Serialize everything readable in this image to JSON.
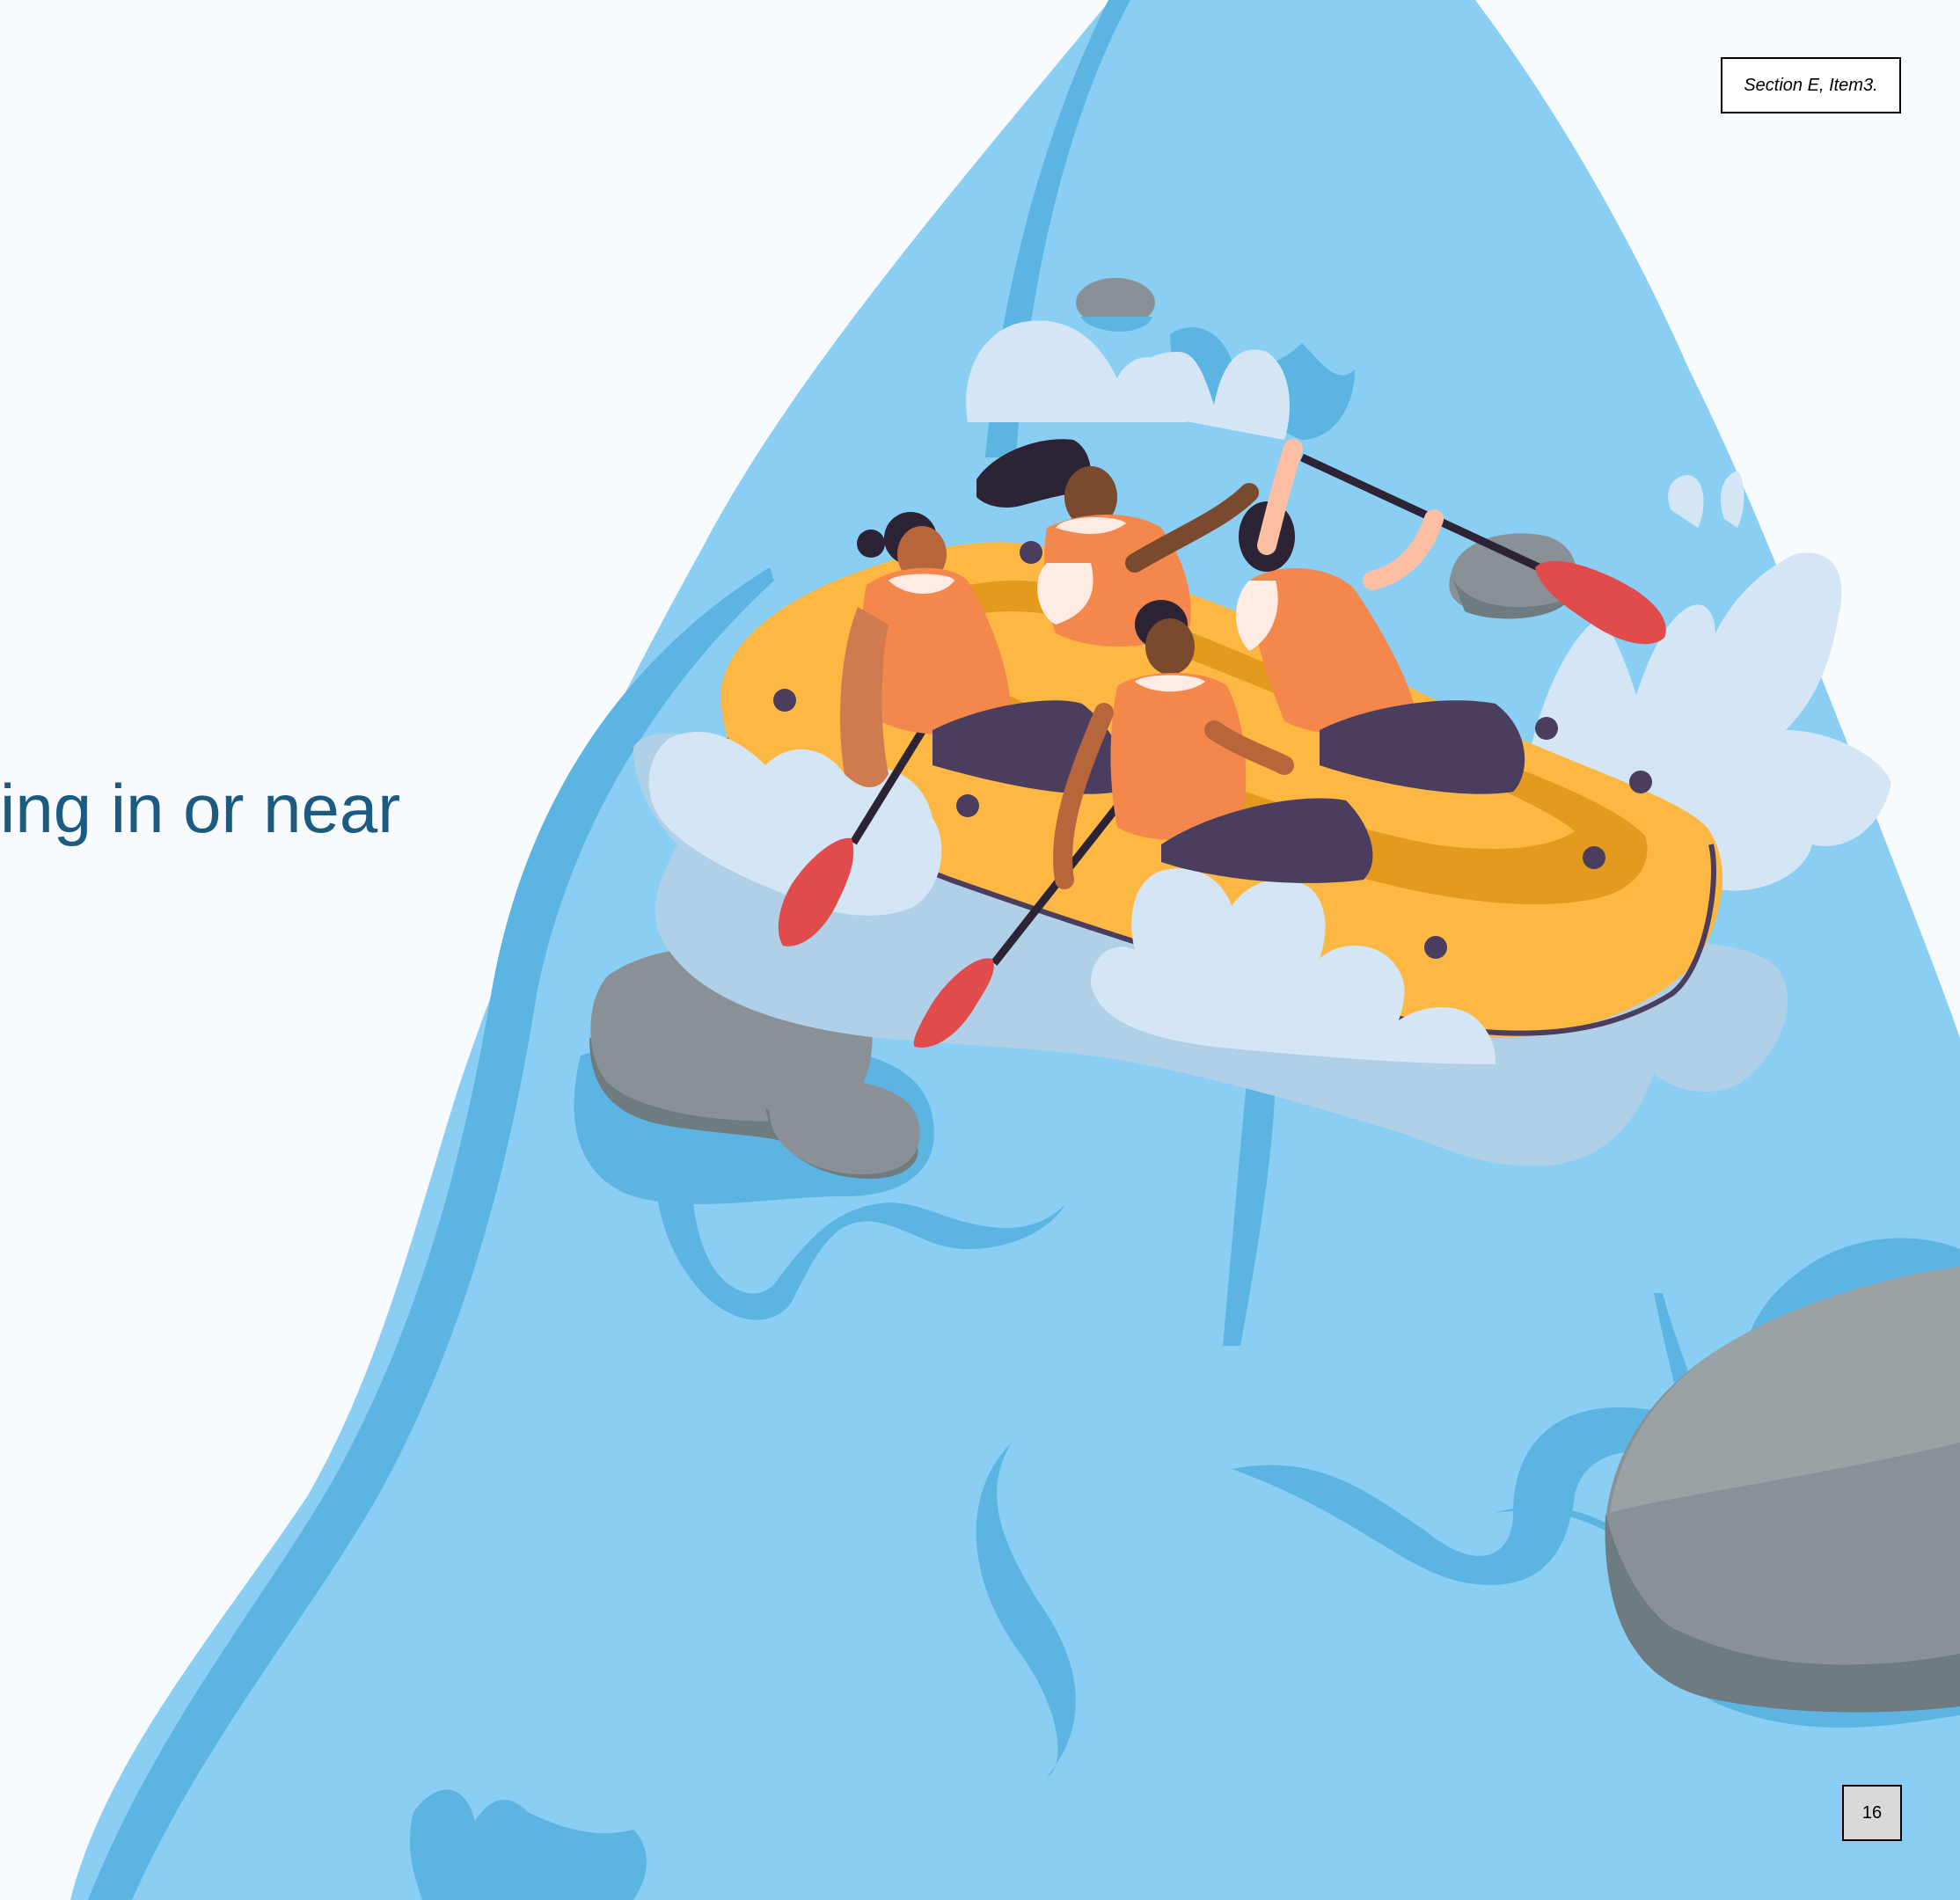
{
  "slide": {
    "heading": "ing in or near",
    "section_tag": "Section E, Item3.",
    "page_number": "16"
  },
  "illustration": {
    "subject": "four people whitewater rafting in a yellow raft on a river",
    "colors": {
      "river_light": "#8acff3",
      "river_dark": "#5cb4e2",
      "splash": "#d4e6f5",
      "raft": "#fdb844",
      "vest": "#f4874b",
      "paddle_blade": "#e14b4b",
      "rock": "#8a9196",
      "heading_text": "#1b5b82"
    }
  }
}
